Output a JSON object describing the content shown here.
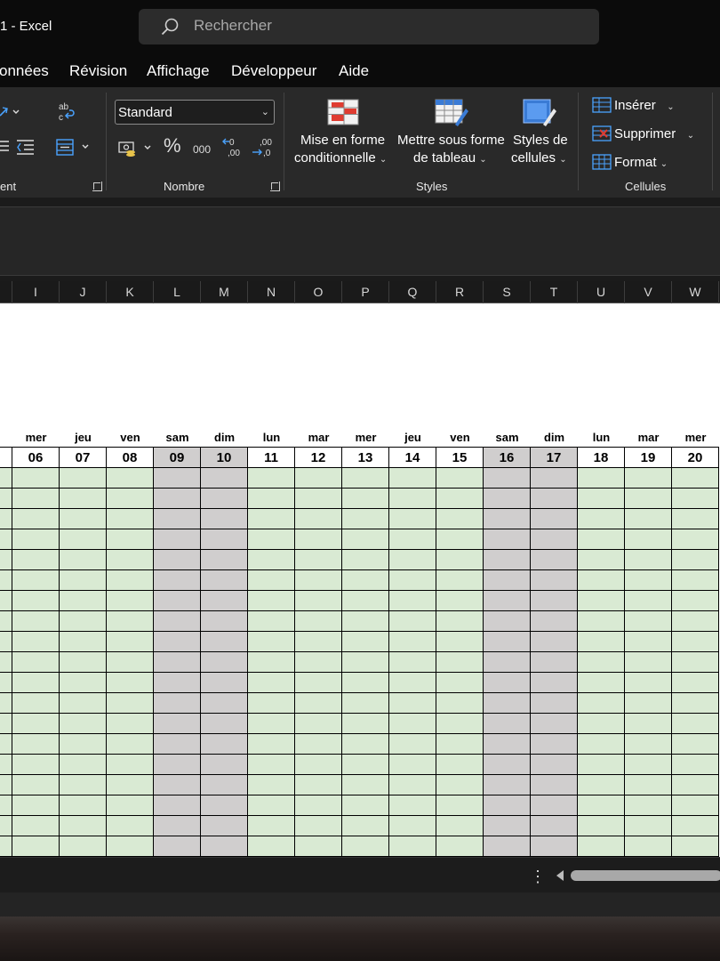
{
  "window": {
    "title": "1  -  Excel"
  },
  "search": {
    "placeholder": "Rechercher"
  },
  "menu_tabs": [
    "onnées",
    "Révision",
    "Affichage",
    "Développeur",
    "Aide"
  ],
  "ribbon": {
    "alignment_group_label": "ent",
    "number_group": {
      "label": "Nombre",
      "format_value": "Standard",
      "percent": "%",
      "thousands": "000",
      "increase_decimals": ",00",
      "decrease_decimals": ",00"
    },
    "styles_group": {
      "label": "Styles",
      "conditional_line1": "Mise en forme",
      "conditional_line2": "conditionnelle",
      "table_line1": "Mettre sous forme",
      "table_line2": "de tableau",
      "cell_styles_line1": "Styles de",
      "cell_styles_line2": "cellules"
    },
    "cells_group": {
      "label": "Cellules",
      "insert": "Insérer",
      "delete": "Supprimer",
      "format": "Format"
    },
    "wrap_text_label": "ab c"
  },
  "columns": [
    "I",
    "J",
    "K",
    "L",
    "M",
    "N",
    "O",
    "P",
    "Q",
    "R",
    "S",
    "T",
    "U",
    "V",
    "W"
  ],
  "days": {
    "partial_left_name": "r",
    "names": [
      "mer",
      "jeu",
      "ven",
      "sam",
      "dim",
      "lun",
      "mar",
      "mer",
      "jeu",
      "ven",
      "sam",
      "dim",
      "lun",
      "mar",
      "mer"
    ],
    "numbers": [
      "06",
      "07",
      "08",
      "09",
      "10",
      "11",
      "12",
      "13",
      "14",
      "15",
      "16",
      "17",
      "18",
      "19",
      "20"
    ],
    "weekend": [
      false,
      false,
      false,
      true,
      true,
      false,
      false,
      false,
      false,
      false,
      true,
      true,
      false,
      false,
      false
    ]
  },
  "colors": {
    "weekday_fill": "#d9ead3",
    "weekend_fill": "#d0cece",
    "ribbon_bg": "#292929",
    "titlebar_bg": "#0b0b0b"
  }
}
